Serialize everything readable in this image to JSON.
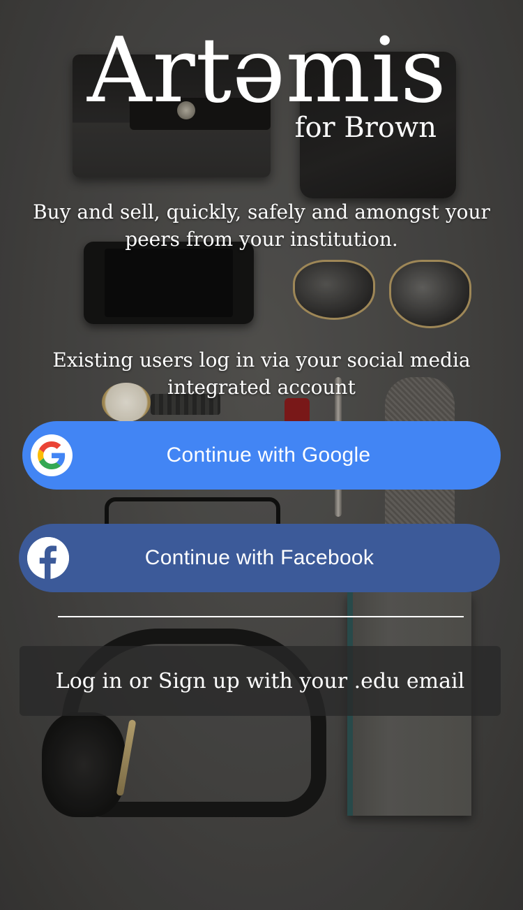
{
  "brand": {
    "title": "Artəmis",
    "subtitle": "for Brown"
  },
  "tagline": "Buy and sell, quickly, safely and amongst your peers from your institution.",
  "login_hint": "Existing users log in via your social media integrated account",
  "buttons": {
    "google": {
      "label": "Continue with Google",
      "icon": "google-icon",
      "color": "#4285f4"
    },
    "facebook": {
      "label": "Continue with Facebook",
      "icon": "facebook-icon",
      "color": "#3c5a99"
    },
    "email": {
      "label": "Log in or Sign up with your .edu email"
    }
  }
}
